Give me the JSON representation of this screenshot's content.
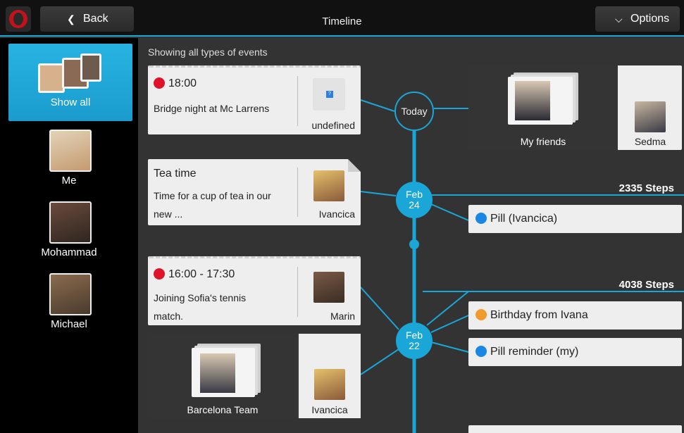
{
  "header": {
    "back_label": "Back",
    "title": "Timeline",
    "options_label": "Options",
    "back_icon": "chevron-left-icon",
    "options_icon": "chevron-down-icon",
    "accent_color": "#1aa6d6"
  },
  "sidebar": {
    "show_all_label": "Show all",
    "people": [
      {
        "label": "Me"
      },
      {
        "label": "Mohammad"
      },
      {
        "label": "Michael"
      }
    ]
  },
  "main": {
    "showing_label": "Showing all types of events",
    "events": {
      "bridge": {
        "time": "18:00",
        "text": "Bridge night at Mc Larrens",
        "side": "undefined"
      },
      "tea": {
        "title": "Tea time",
        "text1": "Time for a cup of tea in our",
        "text2": "new ...",
        "side": "Ivancica"
      },
      "tennis": {
        "time": "16:00 - 17:30",
        "text1": "Joining Sofia's tennis",
        "text2": "match.",
        "side": "Marin"
      },
      "barcelona": {
        "label": "Barcelona Team",
        "side": "Ivancica"
      },
      "friends": {
        "label": "My friends",
        "side": "Sedma"
      }
    },
    "nodes": {
      "today": "Today",
      "feb24_month": "Feb",
      "feb24_day": "24",
      "feb22_month": "Feb",
      "feb22_day": "22"
    },
    "steps": {
      "feb24": "2335 Steps",
      "feb22": "4038 Steps"
    },
    "right_items": {
      "pill_ivancica": "Pill (Ivancica)",
      "birthday": "Birthday from Ivana",
      "pill_reminder": "Pill reminder (my)"
    }
  }
}
